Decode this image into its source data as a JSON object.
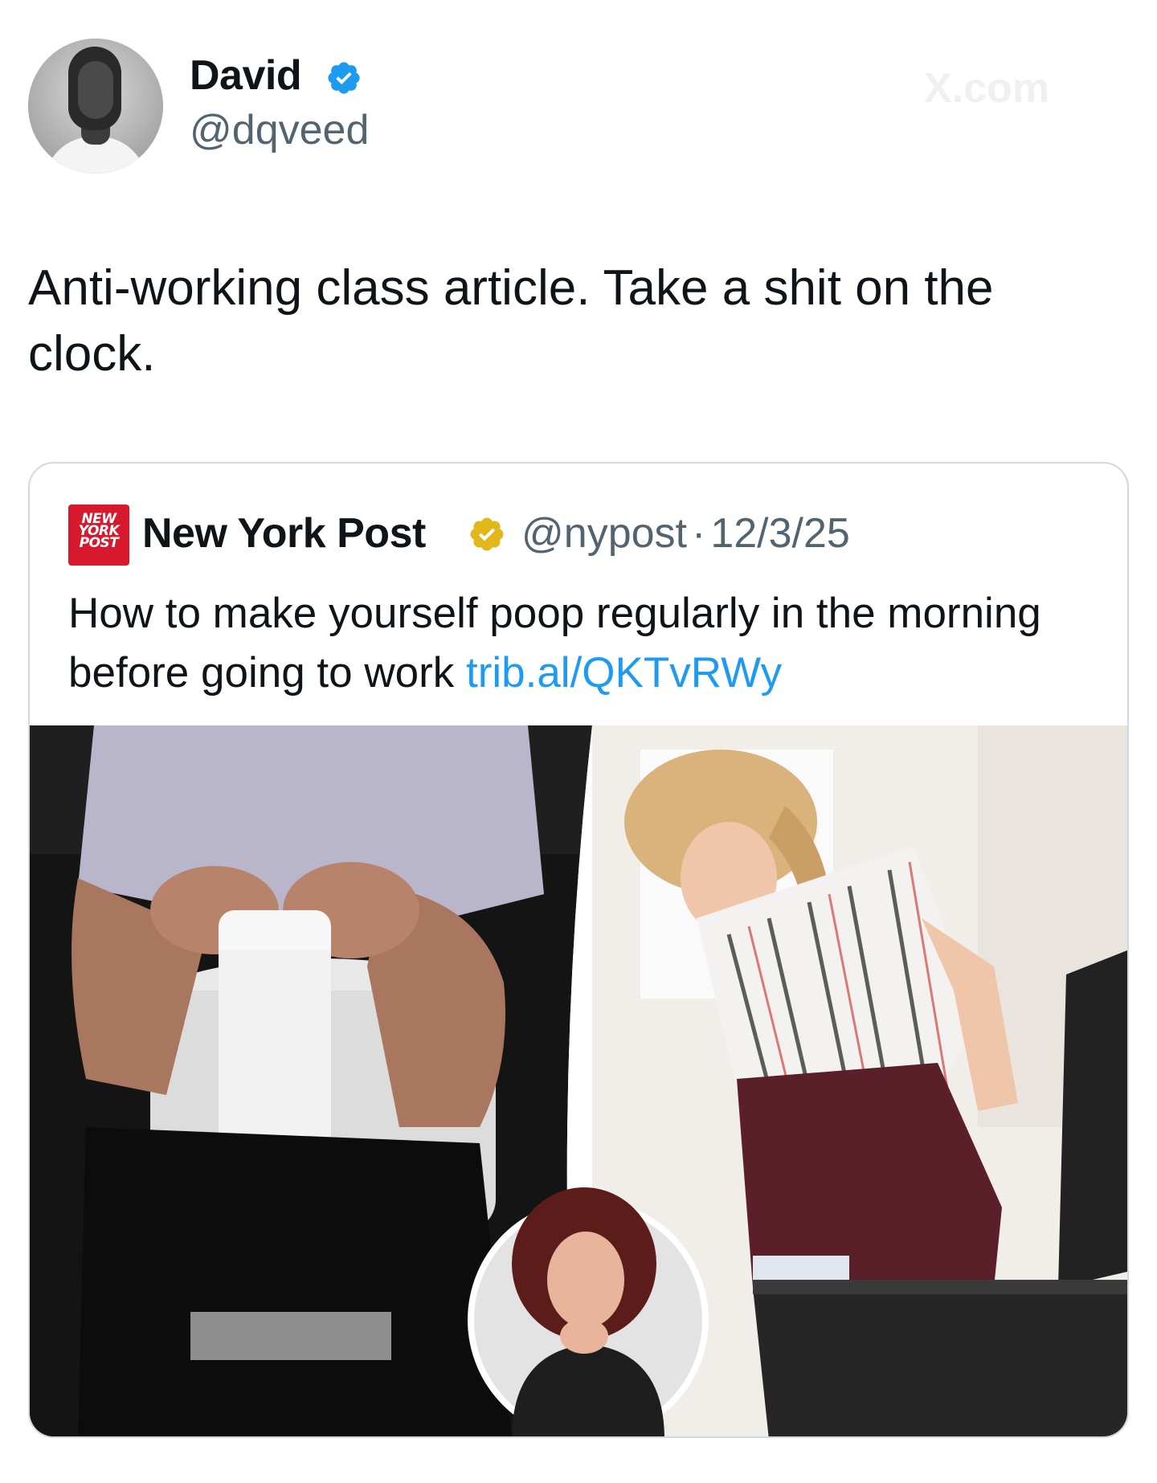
{
  "tweet": {
    "author_name": "David",
    "author_handle": "@dqveed",
    "text": "Anti-working class article. Take a shit on the clock.",
    "watermark": "X.com"
  },
  "quoted": {
    "logo_text": "NEW YORK POST",
    "author_name": "New York Post",
    "author_handle": "@nypost",
    "separator": "·",
    "date": "12/3/25",
    "text": "How to make yourself poop regularly in the morning before going to work ",
    "link": "trib.al/QKTvRWy"
  },
  "colors": {
    "text": "#0f1419",
    "muted": "#536471",
    "link": "#1d9bf0",
    "verified_blue": "#1d9bf0",
    "verified_gold": "#e2b719",
    "nypost_red": "#d7192e"
  },
  "icons": {
    "verified": "verified-badge-icon",
    "gold_verified": "gold-verified-badge-icon"
  }
}
